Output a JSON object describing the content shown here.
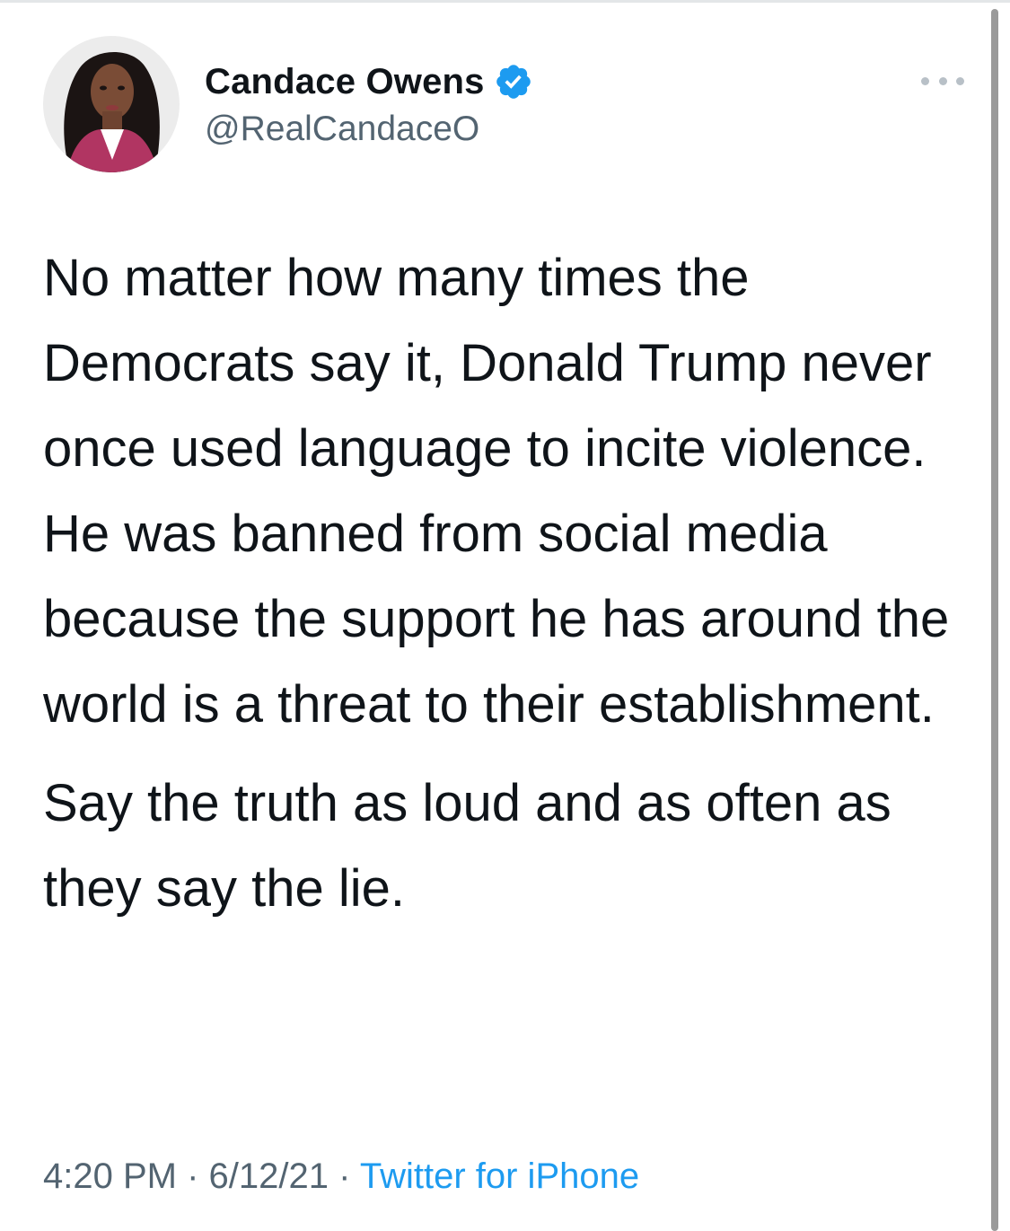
{
  "author": {
    "name": "Candace Owens",
    "handle": "@RealCandaceO",
    "verified": true
  },
  "tweet": {
    "paragraphs": [
      "No matter how many times the Democrats say it, Donald Trump never once used language to incite violence.",
      "He was banned from social media because the support he has around the world is a threat to their establishment.",
      "Say the truth as loud and as often as they say the lie."
    ],
    "time": "4:20 PM",
    "date": "6/12/21",
    "separator": "·",
    "source": "Twitter for iPhone"
  },
  "icons": {
    "verified": "verified-badge-icon",
    "more": "more-options-icon"
  },
  "colors": {
    "verified_blue": "#1d9bf0",
    "link_blue": "#1d9bf0",
    "secondary_text": "#536471",
    "primary_text": "#0f1419"
  }
}
